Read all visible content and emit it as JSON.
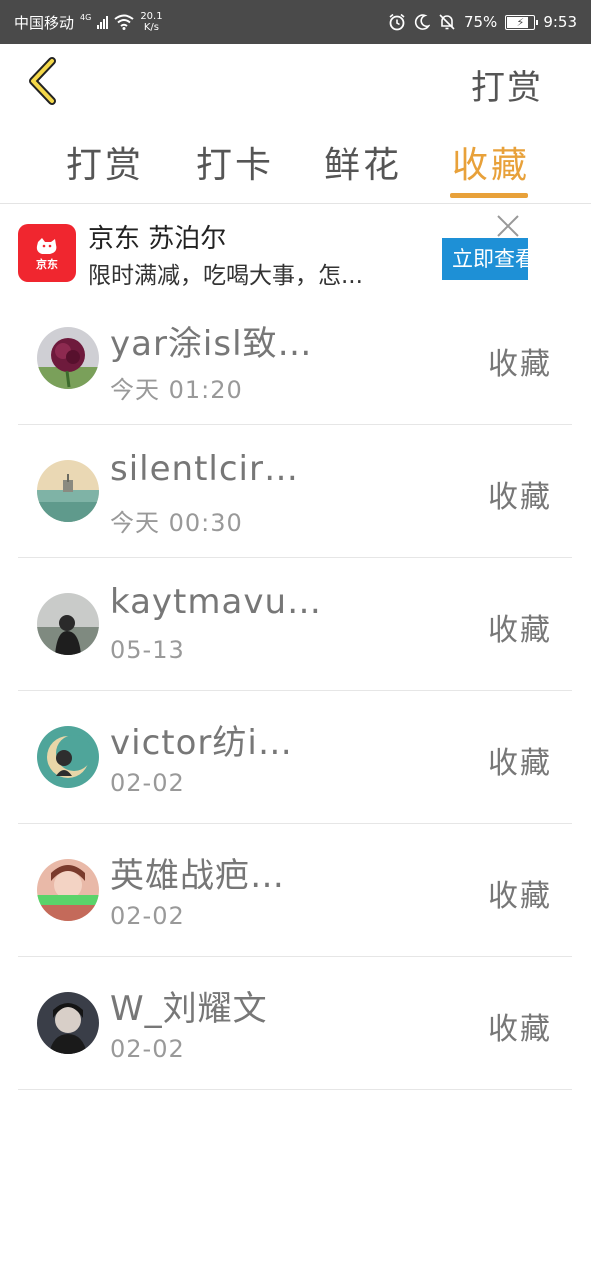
{
  "status_bar": {
    "carrier": "中国移动",
    "network": "4G",
    "speed_value": "20.1",
    "speed_unit": "K/s",
    "battery": "75%",
    "time": "9:53"
  },
  "header": {
    "title": "打赏"
  },
  "tabs": [
    {
      "label": "打赏",
      "active": false
    },
    {
      "label": "打卡",
      "active": false
    },
    {
      "label": "鲜花",
      "active": false
    },
    {
      "label": "收藏",
      "active": true
    }
  ],
  "ad": {
    "title": "京东 苏泊尔",
    "description": "限时满减，吃喝大事，怎...",
    "cta": "立即查看",
    "logo_text": "京东"
  },
  "list": [
    {
      "name": "yar涂isl致…",
      "time": "今天 01:20",
      "action": "收藏",
      "avatar": "rose"
    },
    {
      "name": "silentlcir…",
      "time": "今天 00:30",
      "action": "收藏",
      "avatar": "sea"
    },
    {
      "name": "kaytmavu…",
      "time": "05-13",
      "action": "收藏",
      "avatar": "person-grey"
    },
    {
      "name": "victor纺i…",
      "time": "02-02",
      "action": "收藏",
      "avatar": "moon"
    },
    {
      "name": "英雄战疤…",
      "time": "02-02",
      "action": "收藏",
      "avatar": "girl"
    },
    {
      "name": "W_刘耀文",
      "time": "02-02",
      "action": "收藏",
      "avatar": "boy"
    }
  ]
}
